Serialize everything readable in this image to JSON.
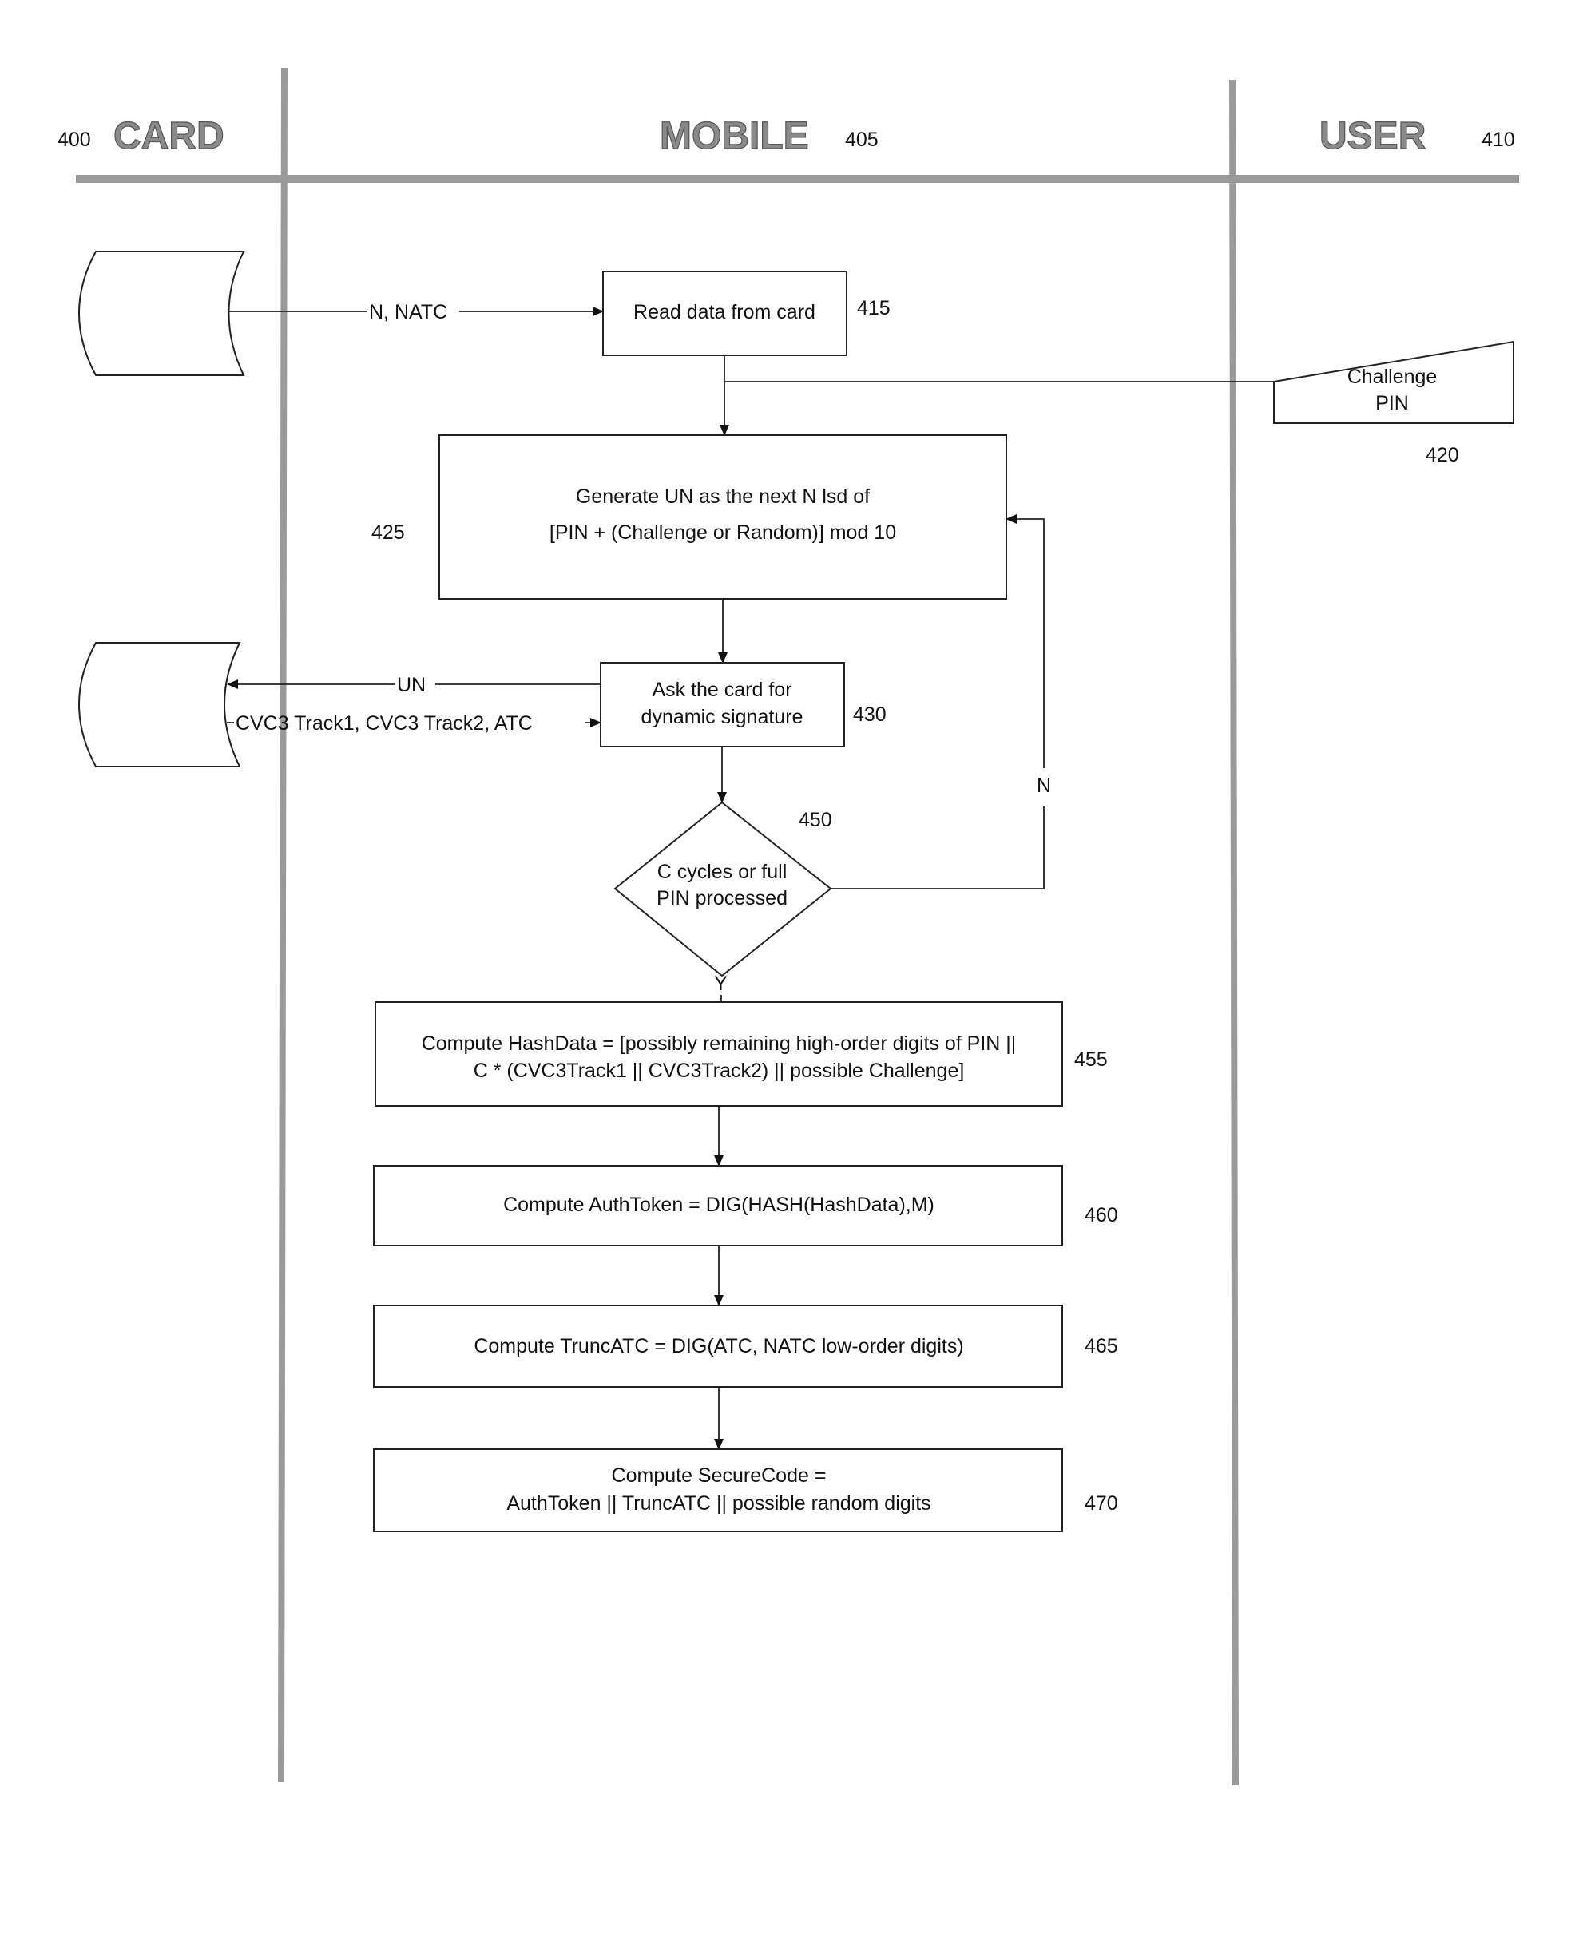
{
  "lanes": [
    {
      "label": "CARD",
      "ref": "400"
    },
    {
      "label": "MOBILE",
      "ref": "405"
    },
    {
      "label": "USER",
      "ref": "410"
    }
  ],
  "flows": {
    "card_to_read": "N, NATC",
    "un_to_card": "UN",
    "card_response": "CVC3 Track1, CVC3 Track2, ATC",
    "loop_no": "N",
    "decision_yes": "Y"
  },
  "steps": {
    "s415": {
      "ref": "415",
      "lines": [
        "Read data from card"
      ]
    },
    "s420": {
      "ref": "420",
      "lines": [
        "Challenge",
        "PIN"
      ]
    },
    "s425": {
      "ref": "425",
      "lines": [
        "Generate UN as the next N lsd of",
        "[PIN + (Challenge or Random)] mod 10"
      ]
    },
    "s430": {
      "ref": "430",
      "lines": [
        "Ask the card for",
        "dynamic signature"
      ]
    },
    "s450": {
      "ref": "450",
      "lines": [
        "C cycles or full",
        "PIN processed"
      ]
    },
    "s455": {
      "ref": "455",
      "lines": [
        "Compute HashData = [possibly remaining high-order digits of PIN ||",
        "C * (CVC3Track1 || CVC3Track2) || possible Challenge]"
      ]
    },
    "s460": {
      "ref": "460",
      "lines": [
        "Compute AuthToken = DIG(HASH(HashData),M)"
      ]
    },
    "s465": {
      "ref": "465",
      "lines": [
        "Compute TruncATC  = DIG(ATC, NATC low-order digits)"
      ]
    },
    "s470": {
      "ref": "470",
      "lines": [
        "Compute SecureCode =",
        "AuthToken || TruncATC || possible random digits"
      ]
    }
  }
}
